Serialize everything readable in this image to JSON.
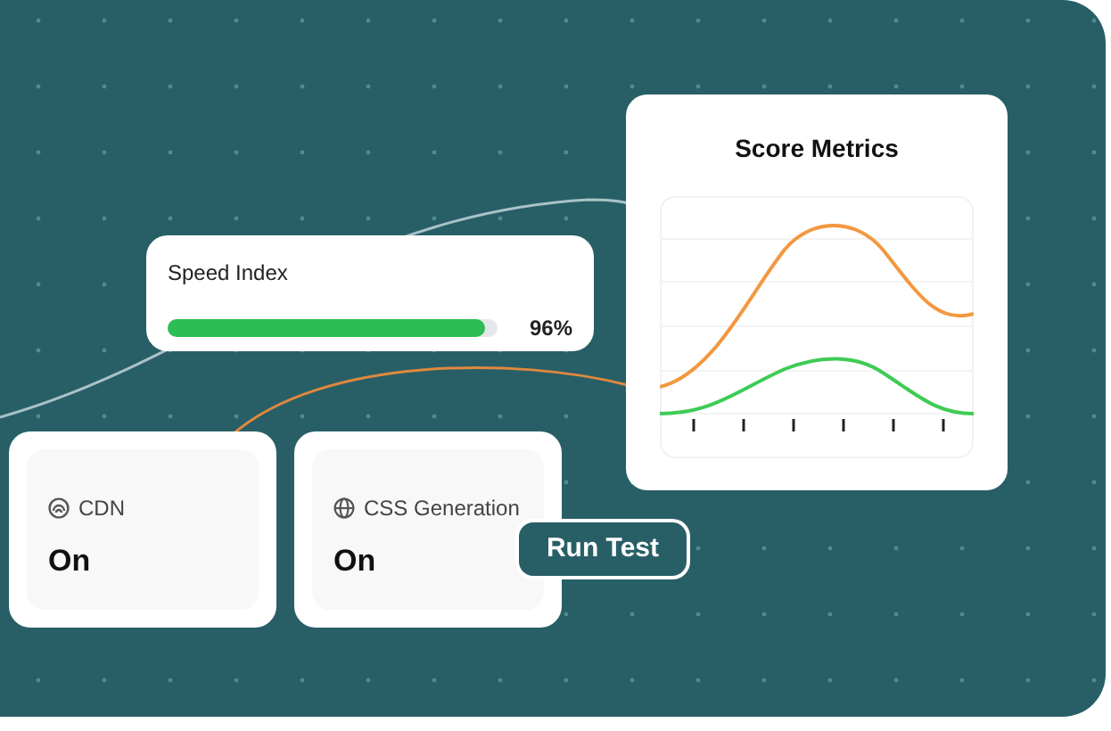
{
  "speed_card": {
    "title": "Speed Index",
    "level": 0.96,
    "reading": "96%"
  },
  "score_card": {
    "title": "Score Metrics"
  },
  "feature_cards": [
    {
      "kind": "cdn",
      "label": "CDN",
      "value": "On"
    },
    {
      "kind": "globe",
      "label": "CSS Generation",
      "value": "On"
    }
  ],
  "run_button": {
    "label": "Run Test"
  }
}
